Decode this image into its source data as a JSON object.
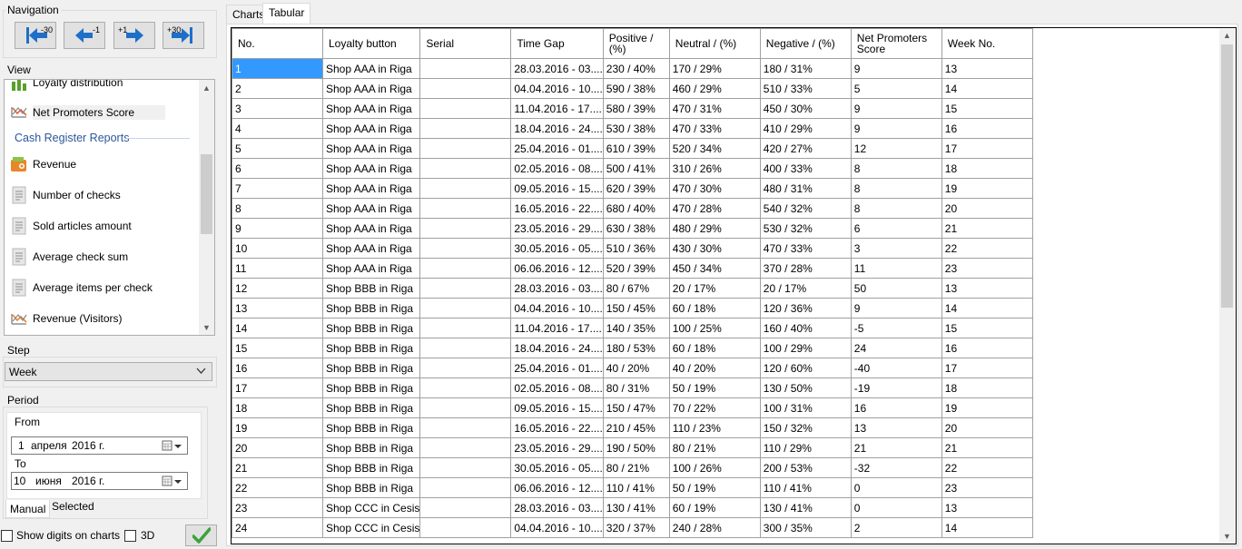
{
  "navigation": {
    "title": "Navigation",
    "buttons": [
      {
        "label": "-30",
        "icon": "first-arrow-icon"
      },
      {
        "label": "-1",
        "icon": "left-arrow-icon"
      },
      {
        "label": "+1",
        "icon": "right-arrow-icon"
      },
      {
        "label": "+30",
        "icon": "last-arrow-icon"
      }
    ]
  },
  "view": {
    "title": "View",
    "items": [
      {
        "label": "Loyalty distribution",
        "icon": "bar-chart-icon"
      },
      {
        "label": "Net Promoters Score",
        "icon": "line-chart-icon",
        "selected": true
      },
      {
        "label": "Revenue",
        "icon": "wallet-icon"
      },
      {
        "label": "Number of checks",
        "icon": "receipt-icon"
      },
      {
        "label": "Sold articles amount",
        "icon": "receipt-icon"
      },
      {
        "label": "Average check sum",
        "icon": "receipt-icon"
      },
      {
        "label": "Average items per check",
        "icon": "receipt-icon"
      },
      {
        "label": "Revenue (Visitors)",
        "icon": "line-chart-icon"
      }
    ],
    "section_header": "Cash Register Reports"
  },
  "step": {
    "title": "Step",
    "value": "Week"
  },
  "period": {
    "title": "Period",
    "from_label": "From",
    "from_day": "1",
    "from_month": "апреля",
    "from_year": "2016 г.",
    "to_label": "To",
    "to_day": "10",
    "to_month": "июня",
    "to_year": "2016 г.",
    "tabs": [
      "Manual",
      "Selected"
    ]
  },
  "options": {
    "show_digits_label": "Show digits on charts",
    "three_d_label": "3D"
  },
  "tabs": [
    "Charts",
    "Tabular"
  ],
  "table": {
    "columns": [
      "No.",
      "Loyalty button",
      "Serial",
      "Time Gap",
      "Positive / (%)",
      "Neutral / (%)",
      "Negative / (%)",
      "Net Promoters Score",
      "Week No."
    ],
    "rows": [
      [
        "1",
        "Shop AAA in Riga",
        "",
        "28.03.2016 - 03....",
        "230 / 40%",
        "170 / 29%",
        "180 / 31%",
        "9",
        "13"
      ],
      [
        "2",
        "Shop AAA in Riga",
        "",
        "04.04.2016 - 10....",
        "590 / 38%",
        "460 / 29%",
        "510 / 33%",
        "5",
        "14"
      ],
      [
        "3",
        "Shop AAA in Riga",
        "",
        "11.04.2016 - 17....",
        "580 / 39%",
        "470 / 31%",
        "450 / 30%",
        "9",
        "15"
      ],
      [
        "4",
        "Shop AAA in Riga",
        "",
        "18.04.2016 - 24....",
        "530 / 38%",
        "470 / 33%",
        "410 / 29%",
        "9",
        "16"
      ],
      [
        "5",
        "Shop AAA in Riga",
        "",
        "25.04.2016 - 01....",
        "610 / 39%",
        "520 / 34%",
        "420 / 27%",
        "12",
        "17"
      ],
      [
        "6",
        "Shop AAA in Riga",
        "",
        "02.05.2016 - 08....",
        "500 / 41%",
        "310 / 26%",
        "400 / 33%",
        "8",
        "18"
      ],
      [
        "7",
        "Shop AAA in Riga",
        "",
        "09.05.2016 - 15....",
        "620 / 39%",
        "470 / 30%",
        "480 / 31%",
        "8",
        "19"
      ],
      [
        "8",
        "Shop AAA in Riga",
        "",
        "16.05.2016 - 22....",
        "680 / 40%",
        "470 / 28%",
        "540 / 32%",
        "8",
        "20"
      ],
      [
        "9",
        "Shop AAA in Riga",
        "",
        "23.05.2016 - 29....",
        "630 / 38%",
        "480 / 29%",
        "530 / 32%",
        "6",
        "21"
      ],
      [
        "10",
        "Shop AAA in Riga",
        "",
        "30.05.2016 - 05....",
        "510 / 36%",
        "430 / 30%",
        "470 / 33%",
        "3",
        "22"
      ],
      [
        "11",
        "Shop AAA in Riga",
        "",
        "06.06.2016 - 12....",
        "520 / 39%",
        "450 / 34%",
        "370 / 28%",
        "11",
        "23"
      ],
      [
        "12",
        "Shop BBB in Riga",
        "",
        "28.03.2016 - 03....",
        "80 / 67%",
        "20 / 17%",
        "20 / 17%",
        "50",
        "13"
      ],
      [
        "13",
        "Shop BBB in Riga",
        "",
        "04.04.2016 - 10....",
        "150 / 45%",
        "60 / 18%",
        "120 / 36%",
        "9",
        "14"
      ],
      [
        "14",
        "Shop BBB in Riga",
        "",
        "11.04.2016 - 17....",
        "140 / 35%",
        "100 / 25%",
        "160 / 40%",
        "-5",
        "15"
      ],
      [
        "15",
        "Shop BBB in Riga",
        "",
        "18.04.2016 - 24....",
        "180 / 53%",
        "60 / 18%",
        "100 / 29%",
        "24",
        "16"
      ],
      [
        "16",
        "Shop BBB in Riga",
        "",
        "25.04.2016 - 01....",
        "40 / 20%",
        "40 / 20%",
        "120 / 60%",
        "-40",
        "17"
      ],
      [
        "17",
        "Shop BBB in Riga",
        "",
        "02.05.2016 - 08....",
        "80 / 31%",
        "50 / 19%",
        "130 / 50%",
        "-19",
        "18"
      ],
      [
        "18",
        "Shop BBB in Riga",
        "",
        "09.05.2016 - 15....",
        "150 / 47%",
        "70 / 22%",
        "100 / 31%",
        "16",
        "19"
      ],
      [
        "19",
        "Shop BBB in Riga",
        "",
        "16.05.2016 - 22....",
        "210 / 45%",
        "110 / 23%",
        "150 / 32%",
        "13",
        "20"
      ],
      [
        "20",
        "Shop BBB in Riga",
        "",
        "23.05.2016 - 29....",
        "190 / 50%",
        "80 / 21%",
        "110 / 29%",
        "21",
        "21"
      ],
      [
        "21",
        "Shop BBB in Riga",
        "",
        "30.05.2016 - 05....",
        "80 / 21%",
        "100 / 26%",
        "200 / 53%",
        "-32",
        "22"
      ],
      [
        "22",
        "Shop BBB in Riga",
        "",
        "06.06.2016 - 12....",
        "110 / 41%",
        "50 / 19%",
        "110 / 41%",
        "0",
        "23"
      ],
      [
        "23",
        "Shop CCC in Cesis",
        "",
        "28.03.2016 - 03....",
        "130 / 41%",
        "60 / 19%",
        "130 / 41%",
        "0",
        "13"
      ],
      [
        "24",
        "Shop CCC in Cesis",
        "",
        "04.04.2016 - 10....",
        "320 / 37%",
        "240 / 28%",
        "300 / 35%",
        "2",
        "14"
      ]
    ]
  },
  "colors": {
    "selection": "#3399ff",
    "accent_blue": "#2b579a",
    "nav_arrow": "#1e6fc8",
    "check_green": "#3ca23c"
  }
}
